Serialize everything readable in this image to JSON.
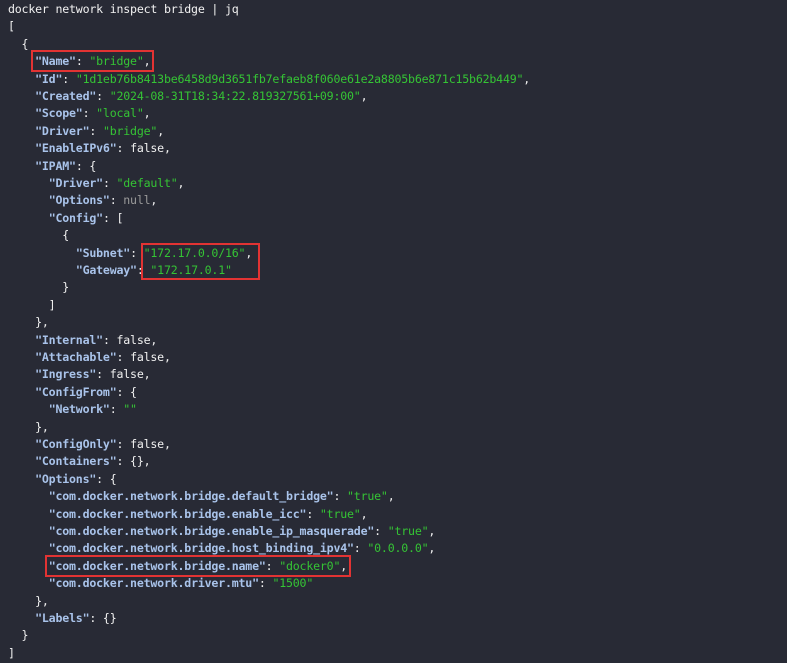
{
  "terminal": {
    "command": "docker network inspect bridge | jq",
    "lines": [
      [],
      [
        {
          "t": "[",
          "c": "p"
        }
      ],
      [
        {
          "t": "  {",
          "c": "p"
        }
      ],
      [
        {
          "t": "    "
        },
        {
          "t": "\"Name\"",
          "c": "k",
          "h": 1
        },
        {
          "t": ": ",
          "c": "p",
          "h": 1
        },
        {
          "t": "\"bridge\"",
          "c": "s",
          "h": 1
        },
        {
          "t": ",",
          "c": "p",
          "h": 1
        }
      ],
      [
        {
          "t": "    "
        },
        {
          "t": "\"Id\"",
          "c": "k"
        },
        {
          "t": ": ",
          "c": "p"
        },
        {
          "t": "\"1d1eb76b8413be6458d9d3651fb7efaeb8f060e61e2a8805b6e871c15b62b449\"",
          "c": "s"
        },
        {
          "t": ",",
          "c": "p"
        }
      ],
      [
        {
          "t": "    "
        },
        {
          "t": "\"Created\"",
          "c": "k"
        },
        {
          "t": ": ",
          "c": "p"
        },
        {
          "t": "\"2024-08-31T18:34:22.819327561+09:00\"",
          "c": "s"
        },
        {
          "t": ",",
          "c": "p"
        }
      ],
      [
        {
          "t": "    "
        },
        {
          "t": "\"Scope\"",
          "c": "k"
        },
        {
          "t": ": ",
          "c": "p"
        },
        {
          "t": "\"local\"",
          "c": "s"
        },
        {
          "t": ",",
          "c": "p"
        }
      ],
      [
        {
          "t": "    "
        },
        {
          "t": "\"Driver\"",
          "c": "k"
        },
        {
          "t": ": ",
          "c": "p"
        },
        {
          "t": "\"bridge\"",
          "c": "s"
        },
        {
          "t": ",",
          "c": "p"
        }
      ],
      [
        {
          "t": "    "
        },
        {
          "t": "\"EnableIPv6\"",
          "c": "k"
        },
        {
          "t": ": ",
          "c": "p"
        },
        {
          "t": "false",
          "c": "b"
        },
        {
          "t": ",",
          "c": "p"
        }
      ],
      [
        {
          "t": "    "
        },
        {
          "t": "\"IPAM\"",
          "c": "k"
        },
        {
          "t": ": {",
          "c": "p"
        }
      ],
      [
        {
          "t": "      "
        },
        {
          "t": "\"Driver\"",
          "c": "k"
        },
        {
          "t": ": ",
          "c": "p"
        },
        {
          "t": "\"default\"",
          "c": "s"
        },
        {
          "t": ",",
          "c": "p"
        }
      ],
      [
        {
          "t": "      "
        },
        {
          "t": "\"Options\"",
          "c": "k"
        },
        {
          "t": ": ",
          "c": "p"
        },
        {
          "t": "null",
          "c": "n"
        },
        {
          "t": ",",
          "c": "p"
        }
      ],
      [
        {
          "t": "      "
        },
        {
          "t": "\"Config\"",
          "c": "k"
        },
        {
          "t": ": [",
          "c": "p"
        }
      ],
      [
        {
          "t": "        {",
          "c": "p"
        }
      ],
      [
        {
          "t": "          "
        },
        {
          "t": "\"Subnet\"",
          "c": "k"
        },
        {
          "t": ": ",
          "c": "p"
        },
        {
          "t": "\"172.17.0.0/16\"",
          "c": "s",
          "h": 2
        },
        {
          "t": ",",
          "c": "p",
          "h": 2
        }
      ],
      [
        {
          "t": "          "
        },
        {
          "t": "\"Gateway\"",
          "c": "k"
        },
        {
          "t": ": ",
          "c": "p"
        },
        {
          "t": "\"172.17.0.1\"",
          "c": "s",
          "h": 2
        }
      ],
      [
        {
          "t": "        }",
          "c": "p"
        }
      ],
      [
        {
          "t": "      ]",
          "c": "p"
        }
      ],
      [
        {
          "t": "    },",
          "c": "p"
        }
      ],
      [
        {
          "t": "    "
        },
        {
          "t": "\"Internal\"",
          "c": "k"
        },
        {
          "t": ": ",
          "c": "p"
        },
        {
          "t": "false",
          "c": "b"
        },
        {
          "t": ",",
          "c": "p"
        }
      ],
      [
        {
          "t": "    "
        },
        {
          "t": "\"Attachable\"",
          "c": "k"
        },
        {
          "t": ": ",
          "c": "p"
        },
        {
          "t": "false",
          "c": "b"
        },
        {
          "t": ",",
          "c": "p"
        }
      ],
      [
        {
          "t": "    "
        },
        {
          "t": "\"Ingress\"",
          "c": "k"
        },
        {
          "t": ": ",
          "c": "p"
        },
        {
          "t": "false",
          "c": "b"
        },
        {
          "t": ",",
          "c": "p"
        }
      ],
      [
        {
          "t": "    "
        },
        {
          "t": "\"ConfigFrom\"",
          "c": "k"
        },
        {
          "t": ": {",
          "c": "p"
        }
      ],
      [
        {
          "t": "      "
        },
        {
          "t": "\"Network\"",
          "c": "k"
        },
        {
          "t": ": ",
          "c": "p"
        },
        {
          "t": "\"\"",
          "c": "s"
        }
      ],
      [
        {
          "t": "    },",
          "c": "p"
        }
      ],
      [
        {
          "t": "    "
        },
        {
          "t": "\"ConfigOnly\"",
          "c": "k"
        },
        {
          "t": ": ",
          "c": "p"
        },
        {
          "t": "false",
          "c": "b"
        },
        {
          "t": ",",
          "c": "p"
        }
      ],
      [
        {
          "t": "    "
        },
        {
          "t": "\"Containers\"",
          "c": "k"
        },
        {
          "t": ": {},",
          "c": "p"
        }
      ],
      [
        {
          "t": "    "
        },
        {
          "t": "\"Options\"",
          "c": "k"
        },
        {
          "t": ": {",
          "c": "p"
        }
      ],
      [
        {
          "t": "      "
        },
        {
          "t": "\"com.docker.network.bridge.default_bridge\"",
          "c": "k"
        },
        {
          "t": ": ",
          "c": "p"
        },
        {
          "t": "\"true\"",
          "c": "s"
        },
        {
          "t": ",",
          "c": "p"
        }
      ],
      [
        {
          "t": "      "
        },
        {
          "t": "\"com.docker.network.bridge.enable_icc\"",
          "c": "k"
        },
        {
          "t": ": ",
          "c": "p"
        },
        {
          "t": "\"true\"",
          "c": "s"
        },
        {
          "t": ",",
          "c": "p"
        }
      ],
      [
        {
          "t": "      "
        },
        {
          "t": "\"com.docker.network.bridge.enable_ip_masquerade\"",
          "c": "k"
        },
        {
          "t": ": ",
          "c": "p"
        },
        {
          "t": "\"true\"",
          "c": "s"
        },
        {
          "t": ",",
          "c": "p"
        }
      ],
      [
        {
          "t": "      "
        },
        {
          "t": "\"com.docker.network.bridge.host_binding_ipv4\"",
          "c": "k"
        },
        {
          "t": ": ",
          "c": "p"
        },
        {
          "t": "\"0.0.0.0\"",
          "c": "s"
        },
        {
          "t": ",",
          "c": "p"
        }
      ],
      [
        {
          "t": "      "
        },
        {
          "t": "\"com.docker.network.bridge.name\"",
          "c": "k",
          "h": 3
        },
        {
          "t": ": ",
          "c": "p",
          "h": 3
        },
        {
          "t": "\"docker0\"",
          "c": "s",
          "h": 3
        },
        {
          "t": ",",
          "c": "p",
          "h": 3
        }
      ],
      [
        {
          "t": "      "
        },
        {
          "t": "\"com.docker.network.driver.mtu\"",
          "c": "k"
        },
        {
          "t": ": ",
          "c": "p"
        },
        {
          "t": "\"1500\"",
          "c": "s"
        }
      ],
      [
        {
          "t": "    },",
          "c": "p"
        }
      ],
      [
        {
          "t": "    "
        },
        {
          "t": "\"Labels\"",
          "c": "k"
        },
        {
          "t": ": {}",
          "c": "p"
        }
      ],
      [
        {
          "t": "  }",
          "c": "p"
        }
      ],
      [
        {
          "t": "]",
          "c": "p"
        }
      ]
    ]
  },
  "colors": {
    "background": "#282a35",
    "key": "#a9c3ea",
    "string": "#35c435",
    "null": "#9a9a9a",
    "highlight_box": "#e23333"
  }
}
